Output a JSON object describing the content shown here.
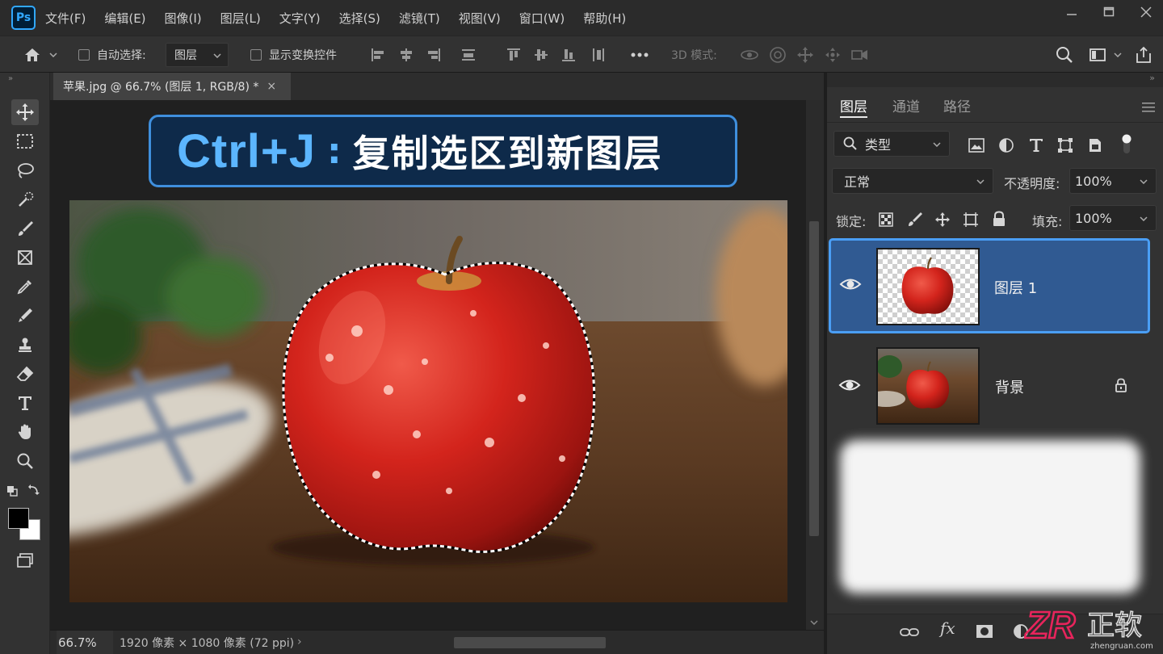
{
  "app": {
    "logo": "Ps"
  },
  "menu": [
    "文件(F)",
    "编辑(E)",
    "图像(I)",
    "图层(L)",
    "文字(Y)",
    "选择(S)",
    "滤镜(T)",
    "视图(V)",
    "窗口(W)",
    "帮助(H)"
  ],
  "options": {
    "auto_select_label": "自动选择:",
    "auto_select_value": "图层",
    "show_transform_label": "显示变换控件",
    "mode_3d_label": "3D 模式:"
  },
  "document": {
    "tab_title": "苹果.jpg @ 66.7% (图层 1, RGB/8) *",
    "close_glyph": "×"
  },
  "banner": {
    "shortcut": "Ctrl+J",
    "colon": ":",
    "description": "复制选区到新图层"
  },
  "status": {
    "zoom": "66.7%",
    "doc_info": "1920 像素 × 1080 像素 (72 ppi)",
    "arrow": "›"
  },
  "panel": {
    "tabs": [
      "图层",
      "通道",
      "路径"
    ],
    "active_tab": "图层",
    "filter_kind": "类型",
    "blend_mode": "正常",
    "opacity_label": "不透明度:",
    "opacity_value": "100%",
    "lock_label": "锁定:",
    "fill_label": "填充:",
    "fill_value": "100%",
    "layers": [
      {
        "name": "图层 1",
        "visible": true,
        "selected": true,
        "locked": false
      },
      {
        "name": "背景",
        "visible": true,
        "selected": false,
        "locked": true
      }
    ],
    "bottom_fx": "fx"
  },
  "watermark": {
    "brand": "ZR",
    "chinese": "正软",
    "url": "zhengruan.com"
  },
  "colors": {
    "accent_blue": "#4a9ef5",
    "selected_layer_bg": "#305a92",
    "banner_bg": "#0e2a4a",
    "banner_key": "#5cb6ff",
    "ps_blue": "#31a8ff"
  }
}
